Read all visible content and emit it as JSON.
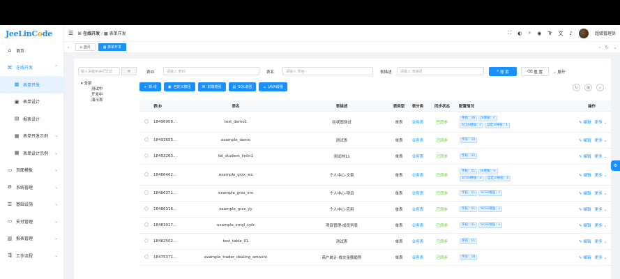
{
  "logo": {
    "text_a": "JeeLin",
    "text_o": "C",
    "text_b": "o",
    "text_c": "de"
  },
  "header": {
    "breadcrumb_parent": "在线开发",
    "breadcrumb_sep": "/",
    "breadcrumb_current": "表单开发",
    "user_name": "超级管理员"
  },
  "tabs": [
    {
      "label": "首页"
    },
    {
      "label": "表单开发"
    }
  ],
  "sidebar": {
    "items": [
      {
        "label": "首页"
      },
      {
        "label": "在线开发"
      },
      {
        "label": "表单开发"
      },
      {
        "label": "表单设计"
      },
      {
        "label": "报表设计"
      },
      {
        "label": "表单开发示例"
      },
      {
        "label": "表单设计示例"
      },
      {
        "label": "页面模板"
      },
      {
        "label": "系统管理"
      },
      {
        "label": "基础设施"
      },
      {
        "label": "支付管理"
      },
      {
        "label": "报表管理"
      },
      {
        "label": "工作流程"
      }
    ]
  },
  "tree": {
    "search_placeholder": "输入关键字进行过滤",
    "add": "+",
    "root": "全部",
    "children": [
      "测试中",
      "开发中",
      "演示表"
    ]
  },
  "filters": {
    "table_id_label": "表ID",
    "table_id_placeholder": "请输入 表ID",
    "table_name_label": "表名",
    "table_name_placeholder": "请输入 表名",
    "table_desc_label": "表描述",
    "table_desc_placeholder": "请输入 表描述",
    "search_btn": "搜 索",
    "reset_btn": "重 置",
    "expand_btn": "展开"
  },
  "toolbar": {
    "add": "新 增",
    "custom_button": "自定义按钮",
    "front_enhance": "前端增强",
    "sql_enhance": "SQL增强",
    "java_enhance": "JAVA增强"
  },
  "columns": {
    "id": "表ID",
    "name": "表名",
    "desc": "表描述",
    "type": "表类型",
    "category": "表分类",
    "sync": "同步状态",
    "config": "配置情况",
    "ops": "操作"
  },
  "rows": [
    {
      "id": "18496908...",
      "name": "test_demo1",
      "desc": "柱状图测试",
      "type": "单表",
      "category": "业务表",
      "sync": "已同步",
      "tags": [
        "字段：16",
        "JS增强：√",
        "SCSS增强：√",
        "自定义按钮：1"
      ],
      "edit": "编辑",
      "more": "更多"
    },
    {
      "id": "18493655...",
      "name": "example_demo",
      "desc": "测试表",
      "type": "单表",
      "category": "业务表",
      "sync": "已同步",
      "tags": [
        "字段：10"
      ],
      "edit": "编辑",
      "more": "更多"
    },
    {
      "id": "18493263...",
      "name": "tbl_student_linlin1",
      "desc": "测试林11",
      "type": "单表",
      "category": "业务表",
      "sync": "已同步",
      "tags": [
        "字段：11"
      ],
      "edit": "编辑",
      "more": "更多"
    },
    {
      "id": "18486462...",
      "name": "example_grzx_wz",
      "desc": "个人中心-文章",
      "type": "单表",
      "category": "业务表",
      "sync": "已同步",
      "tags": [
        "字段：11",
        "JS增强：×",
        "SCSS增强：×",
        "自定义按钮：3"
      ],
      "edit": "编辑",
      "more": "更多"
    },
    {
      "id": "18486371...",
      "name": "example_grzx_xm",
      "desc": "个人中心-项目",
      "type": "单表",
      "category": "业务表",
      "sync": "已同步",
      "tags": [
        "字段：11",
        "SCSS增强：√"
      ],
      "edit": "编辑",
      "more": "更多"
    },
    {
      "id": "18486316...",
      "name": "example_grzx_yy",
      "desc": "个人中心-应用",
      "type": "单表",
      "category": "业务表",
      "sync": "已同步",
      "tags": [
        "字段：11",
        "SCSS增强：√"
      ],
      "edit": "编辑",
      "more": "更多"
    },
    {
      "id": "18483017...",
      "name": "example_xmgl_cyfz",
      "desc": "项目管理-成员列表",
      "type": "单表",
      "category": "业务表",
      "sync": "已同步",
      "tags": [
        "字段：11",
        "SCSS增强：√"
      ],
      "edit": "编辑",
      "more": "更多"
    },
    {
      "id": "18482502...",
      "name": "test_table_01",
      "desc": "测试表",
      "type": "单表",
      "category": "业务表",
      "sync": "已同步",
      "tags": [
        "字段：11"
      ],
      "edit": "编辑",
      "more": "更多"
    },
    {
      "id": "18475371...",
      "name": "example_trader_dealing_amount",
      "desc": "商户统计-成交金额趋势",
      "type": "单表",
      "category": "业务表",
      "sync": "已同步",
      "tags": [
        "字段：18"
      ],
      "edit": "编辑",
      "more": "更多"
    }
  ]
}
